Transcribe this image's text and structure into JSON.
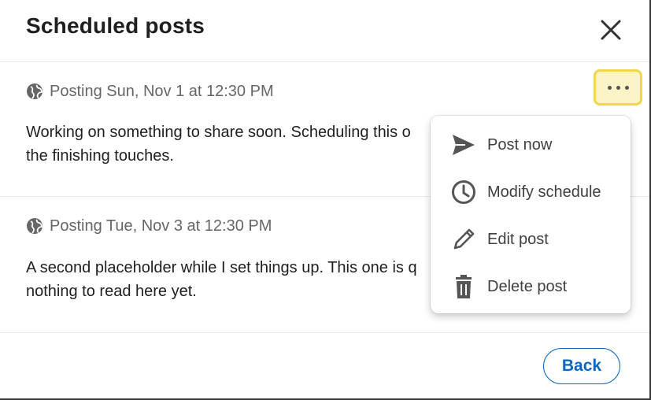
{
  "modal": {
    "title": "Scheduled posts"
  },
  "posts": [
    {
      "schedule": "Posting Sun, Nov 1 at 12:30 PM",
      "text": "Working on something to share soon. Scheduling this o the finishing touches.",
      "text_line1": "Working on something to share soon. Scheduling this o",
      "text_line2": "the finishing touches."
    },
    {
      "schedule": "Posting Tue, Nov 3 at 12:30 PM",
      "text_line1": "A second placeholder while I set things up. This one is q",
      "text_line2": "nothing to read here yet."
    }
  ],
  "menu": {
    "items": [
      {
        "label": "Post now",
        "icon": "send-icon"
      },
      {
        "label": "Modify schedule",
        "icon": "clock-icon"
      },
      {
        "label": "Edit post",
        "icon": "pencil-icon"
      },
      {
        "label": "Delete post",
        "icon": "trash-icon"
      }
    ]
  },
  "footer": {
    "back_label": "Back"
  },
  "colors": {
    "accent": "#0a66c2",
    "highlight_border": "#f2d74b",
    "highlight_fill": "#fbf3c6"
  }
}
